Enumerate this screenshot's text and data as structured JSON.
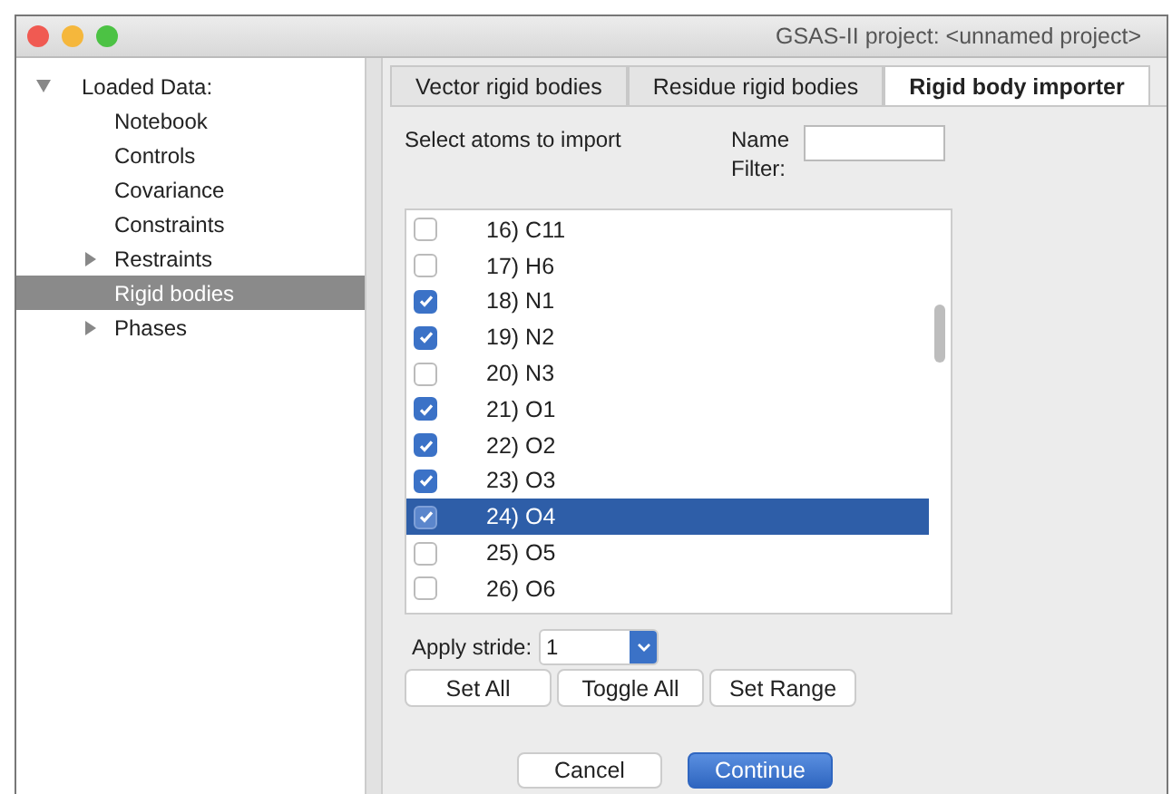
{
  "window": {
    "title": "GSAS-II project: <unnamed project>"
  },
  "sidebar": {
    "items": [
      {
        "label": "Loaded Data:",
        "expanded": true,
        "selected": false,
        "children": [
          {
            "label": "Notebook",
            "selected": false
          },
          {
            "label": "Controls",
            "selected": false
          },
          {
            "label": "Covariance",
            "selected": false
          },
          {
            "label": "Constraints",
            "selected": false
          },
          {
            "label": "Restraints",
            "expanded": false,
            "selected": false
          },
          {
            "label": "Rigid bodies",
            "selected": true
          },
          {
            "label": "Phases",
            "expanded": false,
            "selected": false
          }
        ]
      }
    ]
  },
  "tabs": [
    {
      "label": "Vector rigid bodies",
      "selected": false
    },
    {
      "label": "Residue rigid bodies",
      "selected": false
    },
    {
      "label": "Rigid body importer",
      "selected": true
    }
  ],
  "importer": {
    "instruction": "Select atoms to import",
    "filter": {
      "label": "Name Filter:"
    },
    "atoms": [
      {
        "label": "16) C11",
        "checked": false,
        "selected": false
      },
      {
        "label": "17) H6",
        "checked": false,
        "selected": false
      },
      {
        "label": "18) N1",
        "checked": true,
        "selected": false
      },
      {
        "label": "19) N2",
        "checked": true,
        "selected": false
      },
      {
        "label": "20) N3",
        "checked": false,
        "selected": false
      },
      {
        "label": "21) O1",
        "checked": true,
        "selected": false
      },
      {
        "label": "22) O2",
        "checked": true,
        "selected": false
      },
      {
        "label": "23) O3",
        "checked": true,
        "selected": false
      },
      {
        "label": "24) O4",
        "checked": true,
        "selected": true
      },
      {
        "label": "25) O5",
        "checked": false,
        "selected": false
      },
      {
        "label": "26) O6",
        "checked": false,
        "selected": false
      }
    ],
    "stride": {
      "label": "Apply stride:",
      "value": "1"
    },
    "actions": [
      "Set All",
      "Toggle All",
      "Set Range"
    ],
    "buttons": [
      {
        "label": "Cancel",
        "kind": "normal"
      },
      {
        "label": "Continue",
        "kind": "default"
      }
    ]
  }
}
